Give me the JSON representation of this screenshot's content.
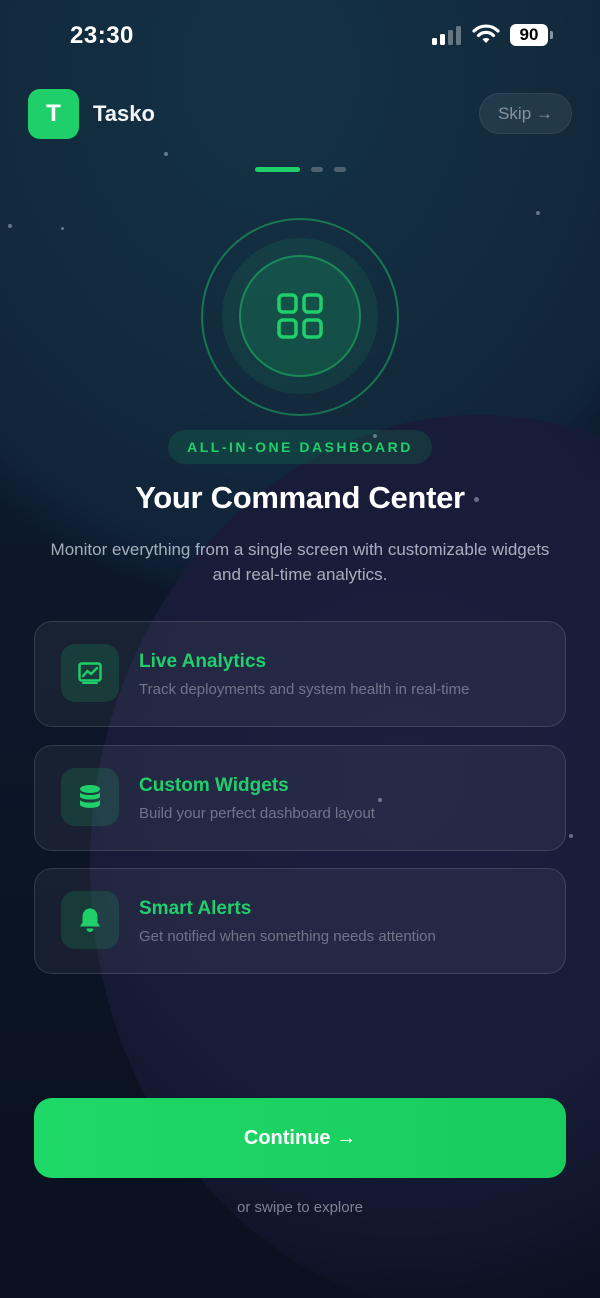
{
  "status_bar": {
    "time": "23:30",
    "battery": "90"
  },
  "header": {
    "logo_letter": "T",
    "app_name": "Tasko",
    "skip_label": "Skip →"
  },
  "pager": {
    "total": 3,
    "active": 0
  },
  "hero": {
    "icon": "grid-icon",
    "tag": "ALL-IN-ONE DASHBOARD",
    "title": "Your Command Center",
    "subtitle": "Monitor everything from a single screen with customizable widgets and real-time analytics."
  },
  "features": [
    {
      "icon": "chart-icon",
      "title": "Live Analytics",
      "description": "Track deployments and system health in real-time"
    },
    {
      "icon": "database-icon",
      "title": "Custom Widgets",
      "description": "Build your perfect dashboard layout"
    },
    {
      "icon": "bell-icon",
      "title": "Smart Alerts",
      "description": "Get notified when something needs attention"
    }
  ],
  "cta": {
    "label": "Continue →",
    "hint": "or swipe to explore"
  },
  "colors": {
    "accent": "#1fd06a",
    "background": "#0b1322"
  }
}
